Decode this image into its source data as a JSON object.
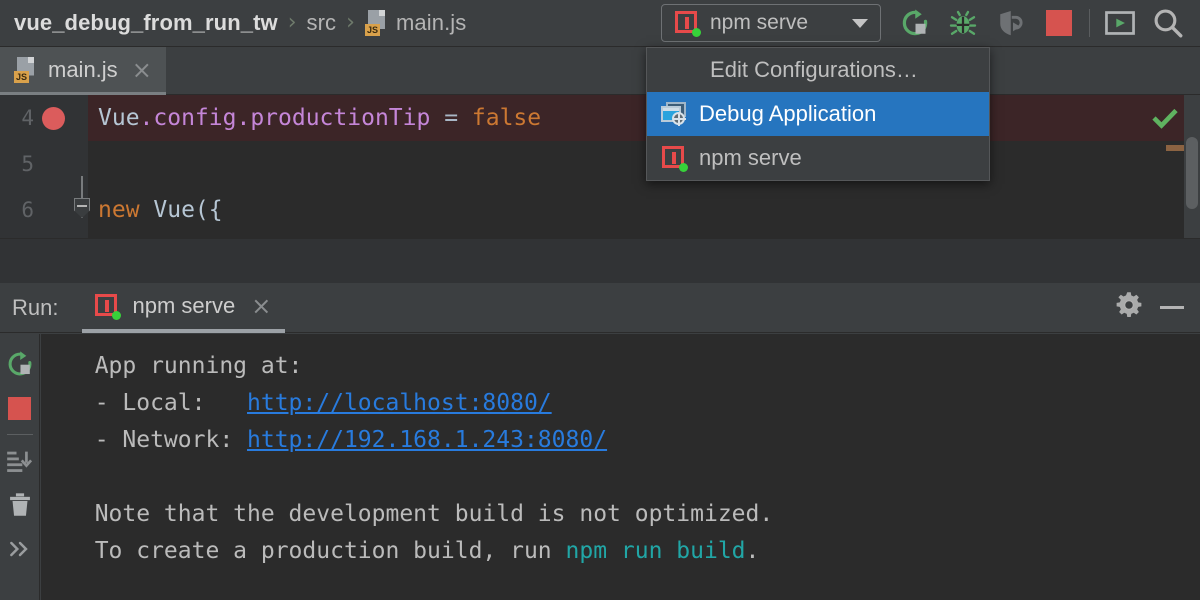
{
  "window": {
    "breadcrumb": {
      "project": "vue_debug_from_run_tw",
      "folder": "src",
      "file": "main.js",
      "separator": "›"
    },
    "toolbar": {
      "run_config_name": "npm serve",
      "run_config_icon": "npm-icon",
      "caret_icon": "chevron-down-icon",
      "buttons": [
        {
          "name": "rerun-button",
          "icon": "rerun-icon",
          "title": "Rerun",
          "color": "#59a869"
        },
        {
          "name": "debug-button",
          "icon": "bug-icon",
          "title": "Debug",
          "color": "#59a869"
        },
        {
          "name": "attach-debugger-button",
          "icon": "attach-debugger-icon",
          "title": "Attach",
          "color": "#6e7174"
        },
        {
          "name": "stop-button",
          "icon": "stop-square-icon",
          "title": "Stop",
          "color": "#d6534f"
        },
        {
          "name": "open-preview-button",
          "icon": "preview-window-icon",
          "title": "Preview",
          "color": "#59a869"
        },
        {
          "name": "search-button",
          "icon": "search-icon",
          "title": "Search",
          "color": "#b4b4b4"
        }
      ]
    }
  },
  "dropdown": {
    "visible": true,
    "items": [
      {
        "label": "Edit Configurations…",
        "icon": "",
        "selected": false
      },
      {
        "label": "Debug Application",
        "icon": "debug-application-icon",
        "selected": true
      },
      {
        "label": "npm serve",
        "icon": "npm-icon",
        "selected": false
      }
    ],
    "highlight_color": "#2675bf"
  },
  "editor": {
    "tabs": [
      {
        "label": "main.js",
        "icon": "js-file-icon",
        "close_icon": "×",
        "active": true
      }
    ],
    "lines": [
      {
        "number": "4",
        "breakpoint": true,
        "highlighted": true,
        "fold": false,
        "tokens": [
          {
            "text": "Vue",
            "type": "default"
          },
          {
            "text": ".config.productionTip",
            "type": "property"
          },
          {
            "text": " = ",
            "type": "operator"
          },
          {
            "text": "false",
            "type": "keyword"
          }
        ]
      },
      {
        "number": "5",
        "breakpoint": false,
        "highlighted": false,
        "fold": false,
        "tokens": []
      },
      {
        "number": "6",
        "breakpoint": false,
        "highlighted": false,
        "fold": true,
        "tokens": [
          {
            "text": "new",
            "type": "keyword"
          },
          {
            "text": " Vue({",
            "type": "default"
          }
        ]
      }
    ],
    "inspection_status": "ok-checkmark",
    "inspection_color": "#5fb360"
  },
  "run_panel": {
    "title": "Run:",
    "tab": {
      "label": "npm serve",
      "icon": "npm-icon",
      "close_icon": "×",
      "active": true
    },
    "header_actions": [
      {
        "name": "settings-button",
        "icon": "gear-icon"
      },
      {
        "name": "minimize-button",
        "icon": "minimize-icon"
      }
    ],
    "side_buttons": [
      {
        "name": "rerun-button",
        "icon": "rerun-icon",
        "color": "#59a869"
      },
      {
        "name": "stop-button",
        "icon": "stop-square-icon",
        "color": "#d6534f"
      },
      {
        "name": "scroll-to-end-button",
        "icon": "scroll-to-end-icon",
        "color": "#8c8f91"
      },
      {
        "name": "clear-all-button",
        "icon": "trash-icon",
        "color": "#b0b3b5"
      },
      {
        "name": "more-options-button",
        "icon": "chevrons-right-icon",
        "color": "#9a9d9f"
      }
    ],
    "console": [
      {
        "segments": [
          {
            "text": "  App running at:",
            "type": "text"
          }
        ]
      },
      {
        "segments": [
          {
            "text": "  - Local:   ",
            "type": "text"
          },
          {
            "text": "http://localhost:8080/",
            "type": "link"
          }
        ]
      },
      {
        "segments": [
          {
            "text": "  - Network: ",
            "type": "text"
          },
          {
            "text": "http://192.168.1.243:8080/",
            "type": "link"
          }
        ]
      },
      {
        "segments": [
          {
            "text": "",
            "type": "text"
          }
        ]
      },
      {
        "segments": [
          {
            "text": "  Note that the development build is not optimized.",
            "type": "text"
          }
        ]
      },
      {
        "segments": [
          {
            "text": "  To create a production build, run ",
            "type": "text"
          },
          {
            "text": "npm run build",
            "type": "command"
          },
          {
            "text": ".",
            "type": "text"
          }
        ]
      }
    ]
  }
}
